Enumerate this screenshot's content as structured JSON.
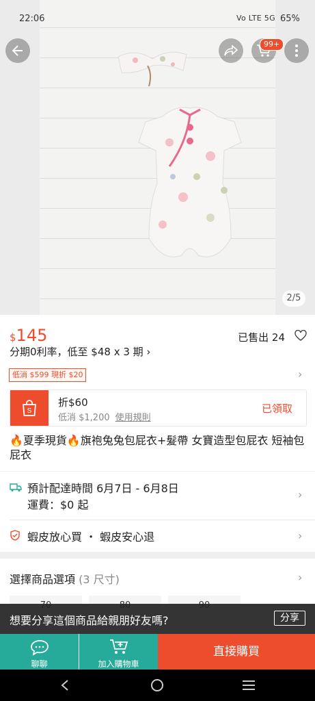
{
  "status_bar": {
    "time": "22:06",
    "network": "Vo LTE 5G",
    "battery": "65%"
  },
  "gallery": {
    "counter": "2/5",
    "cart_badge": "99+"
  },
  "icons": {
    "back": "back-arrow-icon",
    "share": "share-icon",
    "cart": "cart-icon",
    "more": "more-icon"
  },
  "product": {
    "currency": "$",
    "price": "145",
    "sold": "已售出 24",
    "installment": "分期0利率，低至 $48 x 3 期 ›",
    "voucher_tag": "低消 $599 現折 $20",
    "title": "🔥夏季現貨🔥旗袍兔兔包屁衣+髮帶 女寶造型包屁衣 短袖包屁衣"
  },
  "coupon": {
    "title": "折$60",
    "min_spend": "低消 $1,200",
    "rules_link": "使用規則",
    "status": "已領取"
  },
  "shipping": {
    "eta": "預計配達時間 6月7日 - 6月8日",
    "fee": "運費：$0 起"
  },
  "guarantee": {
    "text": "蝦皮放心買 ・ 蝦皮安心退"
  },
  "options": {
    "label": "選擇商品選項",
    "count": "(3 尺寸)",
    "sizes": [
      "70",
      "80",
      "90"
    ]
  },
  "share_prompt": {
    "text": "想要分享這個商品給親朋好友嗎?",
    "button": "分享"
  },
  "bottom_bar": {
    "chat": "聊聊",
    "add_to_cart": "加入購物車",
    "buy_now": "直接購買"
  },
  "colors": {
    "accent": "#ee4d2d",
    "teal": "#26aa99"
  }
}
